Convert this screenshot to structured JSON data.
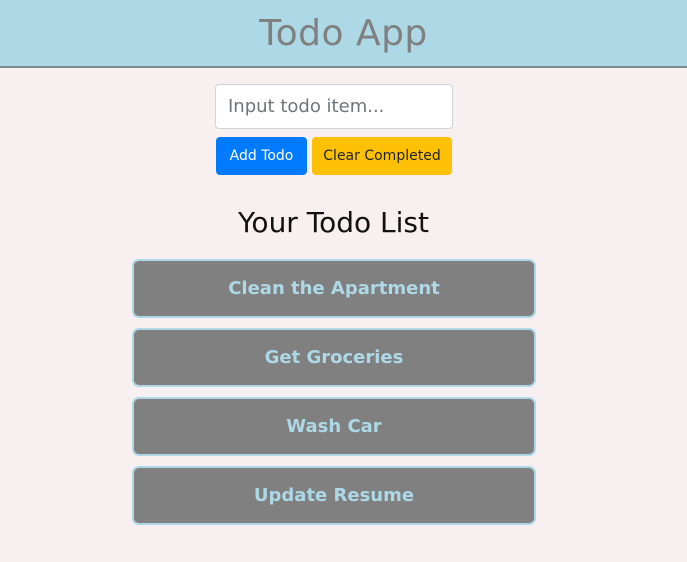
{
  "header": {
    "title": "Todo App"
  },
  "form": {
    "input_placeholder": "Input todo item...",
    "input_value": "",
    "add_label": "Add Todo",
    "clear_label": "Clear Completed"
  },
  "list": {
    "heading": "Your Todo List",
    "items": [
      {
        "label": "Clean the Apartment"
      },
      {
        "label": "Get Groceries"
      },
      {
        "label": "Wash Car"
      },
      {
        "label": "Update Resume"
      }
    ]
  },
  "colors": {
    "header_bg": "#add8e6",
    "page_bg": "#f8eff0",
    "add_button": "#007bff",
    "clear_button": "#ffc107",
    "item_bg": "#808080",
    "item_text": "#add8e6"
  }
}
